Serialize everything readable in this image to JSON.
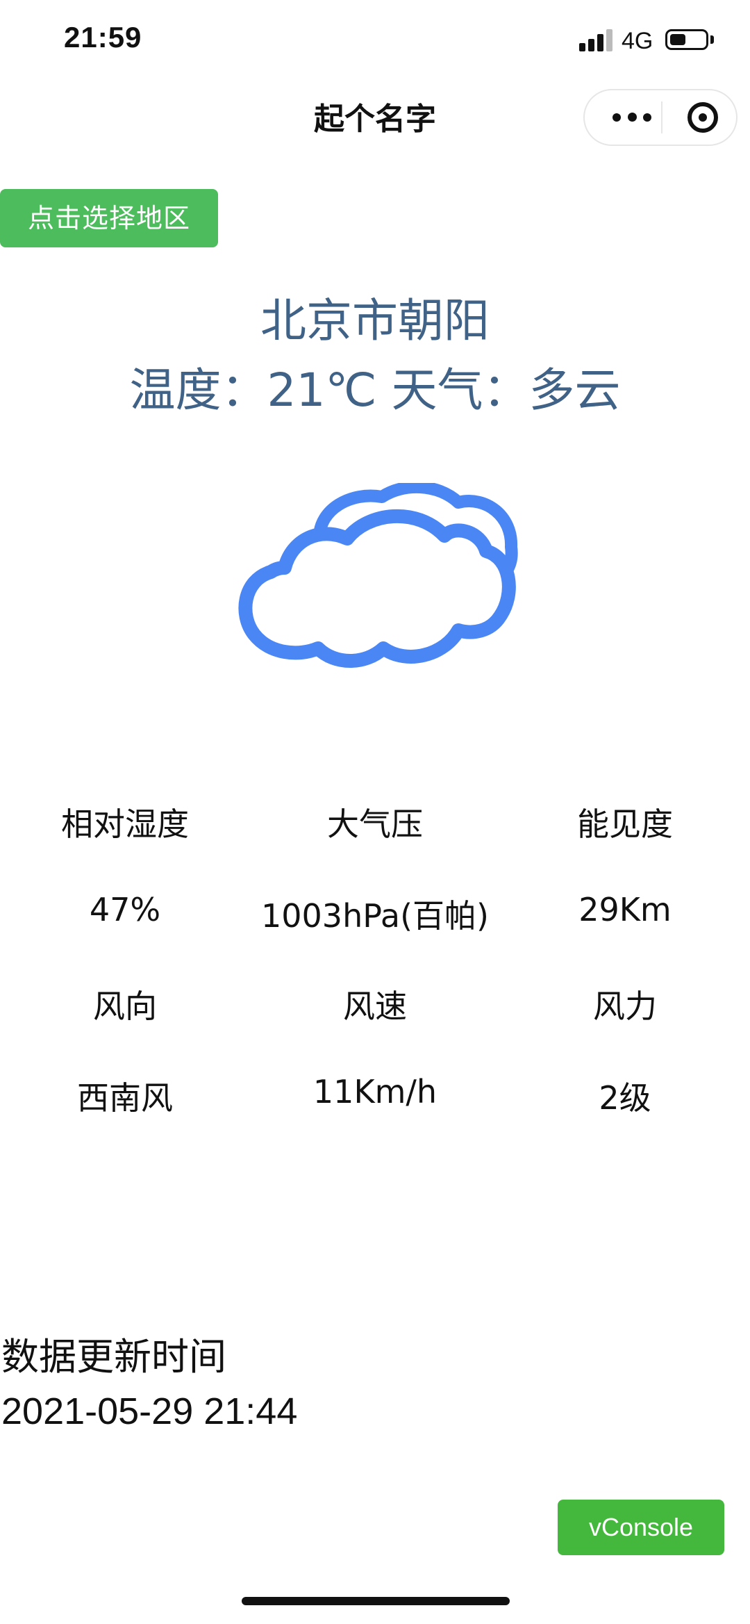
{
  "status_bar": {
    "time": "21:59",
    "network": "4G"
  },
  "nav": {
    "title": "起个名字"
  },
  "select_button": {
    "label": "点击选择地区"
  },
  "weather": {
    "location": "北京市朝阳",
    "temp_line": "温度：21℃ 天气：多云",
    "icon": "cloudy-icon",
    "icon_color": "#4a87f5",
    "text_color": "#3f6286"
  },
  "details": {
    "humidity_label": "相对湿度",
    "pressure_label": "大气压",
    "visibility_label": "能见度",
    "humidity_value": "47%",
    "pressure_value": "1003hPa(百帕)",
    "visibility_value": "29Km",
    "wind_dir_label": "风向",
    "wind_speed_label": "风速",
    "wind_power_label": "风力",
    "wind_dir_value": "西南风",
    "wind_speed_value": "11Km/h",
    "wind_power_value": "2级"
  },
  "update": {
    "label": "数据更新时间",
    "time": "2021-05-29 21:44"
  },
  "vconsole": {
    "label": "vConsole",
    "color": "#44b83c"
  },
  "accent_color": "#4cbc5c"
}
